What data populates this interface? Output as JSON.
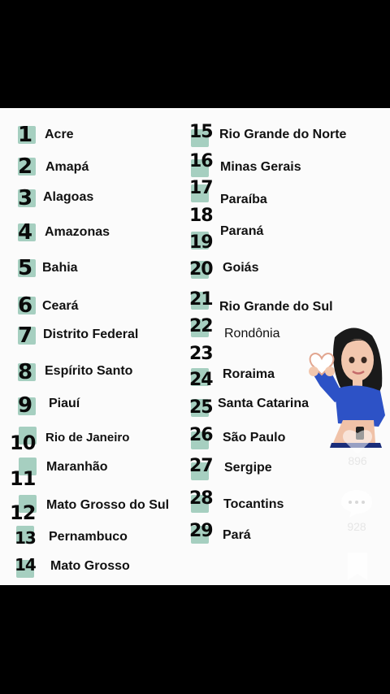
{
  "states": [
    {
      "n": "1",
      "name": "Acre"
    },
    {
      "n": "2",
      "name": "Amapá"
    },
    {
      "n": "3",
      "name": "Alagoas"
    },
    {
      "n": "4",
      "name": "Amazonas"
    },
    {
      "n": "5",
      "name": "Bahia"
    },
    {
      "n": "6",
      "name": "Ceará"
    },
    {
      "n": "7",
      "name": "Distrito Federal"
    },
    {
      "n": "8",
      "name": "Espírito Santo"
    },
    {
      "n": "9",
      "name": "Piauí"
    },
    {
      "n": "10",
      "name": "Rio de Janeiro"
    },
    {
      "n": "11",
      "name": "Maranhão"
    },
    {
      "n": "12",
      "name": "Mato Grosso do Sul"
    },
    {
      "n": "13",
      "name": "Pernambuco"
    },
    {
      "n": "14",
      "name": "Mato Grosso"
    },
    {
      "n": "15",
      "name": "Rio Grande do Norte"
    },
    {
      "n": "16",
      "name": "Minas Gerais"
    },
    {
      "n": "17",
      "name": "Paraíba"
    },
    {
      "n": "18",
      "name": "Paraná"
    },
    {
      "n": "19",
      "name": ""
    },
    {
      "n": "20",
      "name": "Goiás"
    },
    {
      "n": "21",
      "name": "Rio Grande do Sul"
    },
    {
      "n": "22",
      "name": "Rondônia"
    },
    {
      "n": "23",
      "name": ""
    },
    {
      "n": "24",
      "name": "Roraima"
    },
    {
      "n": "25",
      "name": "Santa Catarina"
    },
    {
      "n": "26",
      "name": "São Paulo"
    },
    {
      "n": "27",
      "name": "Sergipe"
    },
    {
      "n": "28",
      "name": "Tocantins"
    },
    {
      "n": "29",
      "name": "Pará"
    }
  ],
  "side": {
    "like_count": "896",
    "comment_count": "928",
    "icons": [
      "heart-icon",
      "comment-icon",
      "bookmark-icon"
    ]
  },
  "colors": {
    "number_box": "#a6cfc0",
    "background": "#fbfbfb",
    "letterbox": "#000000"
  }
}
